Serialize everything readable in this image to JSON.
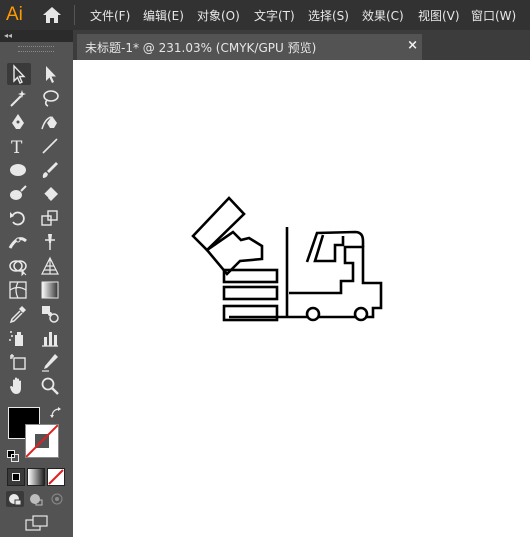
{
  "app": {
    "logo_text": "Ai"
  },
  "menu": [
    {
      "label": "文件(F)"
    },
    {
      "label": "编辑(E)"
    },
    {
      "label": "对象(O)"
    },
    {
      "label": "文字(T)"
    },
    {
      "label": "选择(S)"
    },
    {
      "label": "效果(C)"
    },
    {
      "label": "视图(V)"
    },
    {
      "label": "窗口(W)"
    }
  ],
  "toolbar_header": {
    "collapse_glyph": "◂◂"
  },
  "tab": {
    "title": "未标题-1* @ 231.03% (CMYK/GPU 预览)",
    "close_glyph": "×"
  },
  "tools": [
    {
      "name": "selection-tool-icon"
    },
    {
      "name": "direct-selection-tool-icon"
    },
    {
      "name": "magic-wand-tool-icon"
    },
    {
      "name": "lasso-tool-icon"
    },
    {
      "name": "pen-tool-icon"
    },
    {
      "name": "curvature-tool-icon"
    },
    {
      "name": "type-tool-icon",
      "glyph": "T"
    },
    {
      "name": "line-segment-tool-icon"
    },
    {
      "name": "ellipse-tool-icon"
    },
    {
      "name": "paintbrush-tool-icon"
    },
    {
      "name": "shaper-tool-icon"
    },
    {
      "name": "eraser-tool-icon"
    },
    {
      "name": "rotate-tool-icon"
    },
    {
      "name": "scale-tool-icon"
    },
    {
      "name": "width-tool-icon"
    },
    {
      "name": "puppet-warp-tool-icon"
    },
    {
      "name": "shape-builder-tool-icon"
    },
    {
      "name": "perspective-grid-tool-icon"
    },
    {
      "name": "mesh-tool-icon"
    },
    {
      "name": "gradient-tool-icon"
    },
    {
      "name": "eyedropper-tool-icon"
    },
    {
      "name": "blend-tool-icon"
    },
    {
      "name": "symbol-sprayer-tool-icon"
    },
    {
      "name": "column-graph-tool-icon"
    },
    {
      "name": "artboard-tool-icon"
    },
    {
      "name": "slice-tool-icon"
    },
    {
      "name": "hand-tool-icon"
    },
    {
      "name": "zoom-tool-icon"
    }
  ],
  "colors": {
    "fill": "#000000",
    "stroke": "#ffffff",
    "none_slash": "#e02020",
    "logo": "#ff9a00"
  }
}
